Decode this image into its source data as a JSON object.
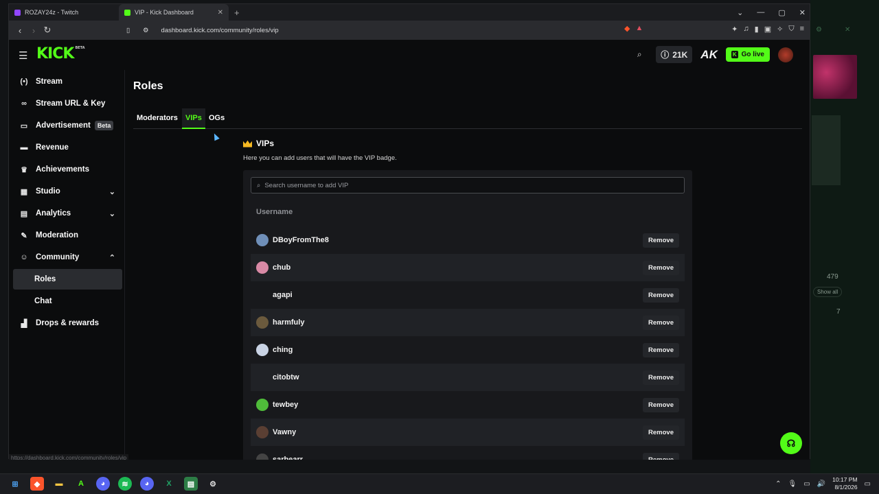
{
  "browser": {
    "tabs": [
      {
        "title": "ROZAY24z - Twitch",
        "color": "#9146ff",
        "active": false
      },
      {
        "title": "VIP - Kick Dashboard",
        "color": "#53fc18",
        "active": true
      }
    ],
    "url": "dashboard.kick.com/community/roles/vip",
    "status_url": "https://dashboard.kick.com/community/roles/vip"
  },
  "brand": {
    "logo": "KICK",
    "logo_sup": "BETA",
    "accent": "#53fc18"
  },
  "topbar": {
    "kicks_count": "21K",
    "ak_mark": "AK",
    "go_live": "Go live"
  },
  "sidebar": {
    "items": [
      {
        "label": "Stream",
        "icon": "broadcast-icon"
      },
      {
        "label": "Stream URL & Key",
        "icon": "link-icon"
      },
      {
        "label": "Advertisement",
        "icon": "ad-icon",
        "badge": "Beta"
      },
      {
        "label": "Revenue",
        "icon": "revenue-icon"
      },
      {
        "label": "Achievements",
        "icon": "trophy-icon"
      },
      {
        "label": "Studio",
        "icon": "studio-icon"
      },
      {
        "label": "Analytics",
        "icon": "analytics-icon"
      },
      {
        "label": "Moderation",
        "icon": "wrench-icon"
      },
      {
        "label": "Community",
        "icon": "community-icon"
      },
      {
        "label": "Roles"
      },
      {
        "label": "Chat"
      },
      {
        "label": "Drops & rewards",
        "icon": "drops-icon"
      }
    ]
  },
  "main": {
    "title": "Roles",
    "tabs": [
      {
        "label": "Moderators"
      },
      {
        "label": "VIPs"
      },
      {
        "label": "OGs"
      }
    ],
    "section_title": "VIPs",
    "section_desc": "Here you can add users that will have the VIP badge.",
    "search_placeholder": "Search username to add VIP",
    "column_header": "Username",
    "remove_label": "Remove",
    "users": [
      {
        "name": "DBoyFromThe8",
        "avatar_color": "#6f8fb8"
      },
      {
        "name": "chub",
        "avatar_color": "#d889a5"
      },
      {
        "name": "agapi",
        "avatar_color": ""
      },
      {
        "name": "harmfuly",
        "avatar_color": "#6b5a3d"
      },
      {
        "name": "ching",
        "avatar_color": "#c9d3e4"
      },
      {
        "name": "citobtw",
        "avatar_color": ""
      },
      {
        "name": "tewbey",
        "avatar_color": "#4fbb3a"
      },
      {
        "name": "Vawny",
        "avatar_color": "#5a3f33"
      },
      {
        "name": "sarbearr",
        "avatar_color": "#444"
      }
    ]
  },
  "background_window": {
    "count_a": "479",
    "show_all": "Show all",
    "count_b": "7"
  },
  "taskbar": {
    "time": "10:17 PM",
    "date": "8/1/2026"
  }
}
